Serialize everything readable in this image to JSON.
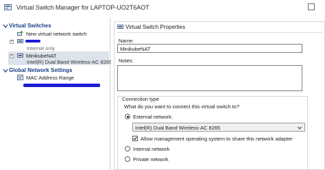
{
  "window": {
    "title": "Virtual Switch Manager for LAPTOP-UO2T6AOT",
    "icon": "virtual-switch-manager-icon",
    "controls": [
      "maximize-icon"
    ]
  },
  "left_pane": {
    "virtual_switches_header": "Virtual Switches",
    "items": [
      {
        "label": "New virtual network switch",
        "icon": "add-switch-icon"
      },
      {
        "label": "",
        "sublabel": "Internal only",
        "icon": "switch-icon",
        "redacted": true
      },
      {
        "label": "MinikubeNAT",
        "sublabel": "Intel(R) Dual Band Wireless-AC 8265",
        "icon": "switch-icon",
        "selected": true
      }
    ],
    "global_settings_header": "Global Network Settings",
    "global_items": [
      {
        "label": "MAC Address Range",
        "icon": "mac-address-icon",
        "redacted": true
      }
    ]
  },
  "properties": {
    "header": "Virtual Switch Properties",
    "name_label": "Name:",
    "name_value": "MinikubeNAT",
    "notes_label": "Notes:",
    "notes_value": "",
    "connection_type": {
      "heading": "Connection type",
      "question": "What do you want to connect this virtual switch to?",
      "external_label": "External network:",
      "adapter_selected": "Intel(R) Dual Band Wireless-AC 8265",
      "allow_mgmt_label": "Allow management operating system to share this network adapter",
      "allow_mgmt_checked": true,
      "internal_label": "Internal network",
      "private_label": "Private network",
      "selected": "external"
    }
  },
  "colors": {
    "header_text": "#1a3f86",
    "selection": "#dde3ea",
    "redaction": "#1b1bd8"
  }
}
